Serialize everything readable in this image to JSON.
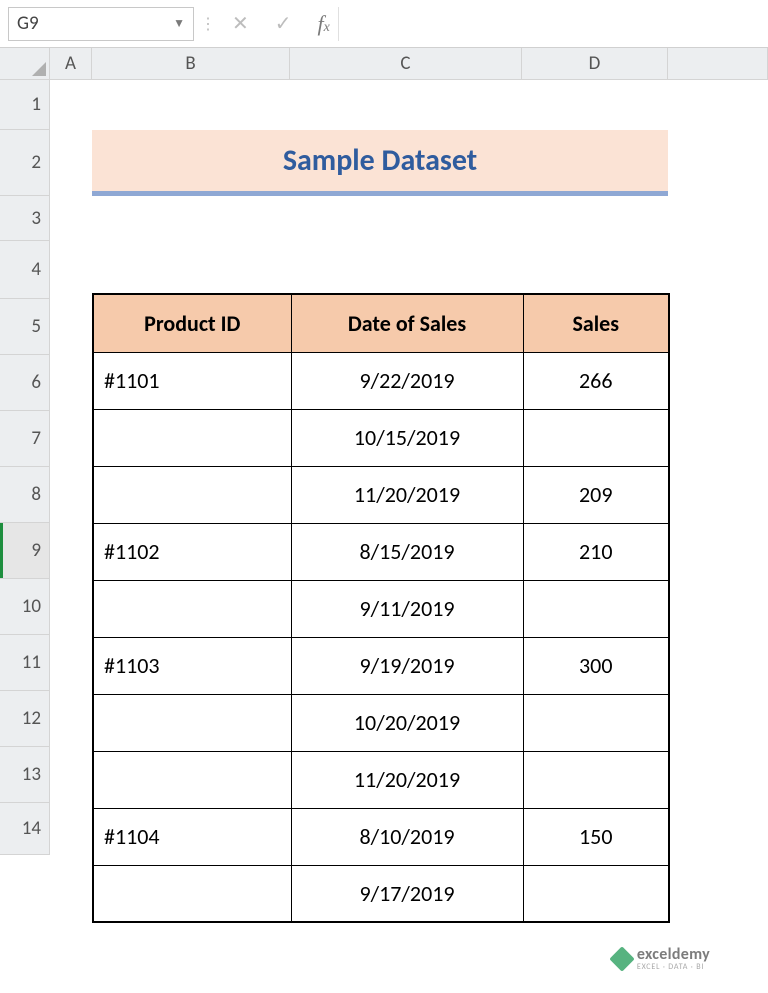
{
  "name_box": "G9",
  "formula_value": "",
  "columns": [
    "A",
    "B",
    "C",
    "D"
  ],
  "row_numbers": [
    "1",
    "2",
    "3",
    "4",
    "5",
    "6",
    "7",
    "8",
    "9",
    "10",
    "11",
    "12",
    "13",
    "14"
  ],
  "selected_row": "9",
  "title": "Sample Dataset",
  "table": {
    "headers": {
      "b": "Product ID",
      "c": "Date of Sales",
      "d": "Sales"
    },
    "rows": [
      {
        "b": "#1101",
        "c": "9/22/2019",
        "d": "266"
      },
      {
        "b": "",
        "c": "10/15/2019",
        "d": ""
      },
      {
        "b": "",
        "c": "11/20/2019",
        "d": "209"
      },
      {
        "b": "#1102",
        "c": "8/15/2019",
        "d": "210"
      },
      {
        "b": "",
        "c": "9/11/2019",
        "d": ""
      },
      {
        "b": "#1103",
        "c": "9/19/2019",
        "d": "300"
      },
      {
        "b": "",
        "c": "10/20/2019",
        "d": ""
      },
      {
        "b": "",
        "c": "11/20/2019",
        "d": ""
      },
      {
        "b": "#1104",
        "c": "8/10/2019",
        "d": "150"
      },
      {
        "b": "",
        "c": "9/17/2019",
        "d": ""
      }
    ]
  },
  "watermark": {
    "name": "exceldemy",
    "tag": "EXCEL · DATA · BI"
  },
  "colors": {
    "header_bg": "#f6caab",
    "title_bg": "#fbe3d5",
    "title_underline": "#8fa8d4",
    "title_text": "#2f5c9e"
  }
}
